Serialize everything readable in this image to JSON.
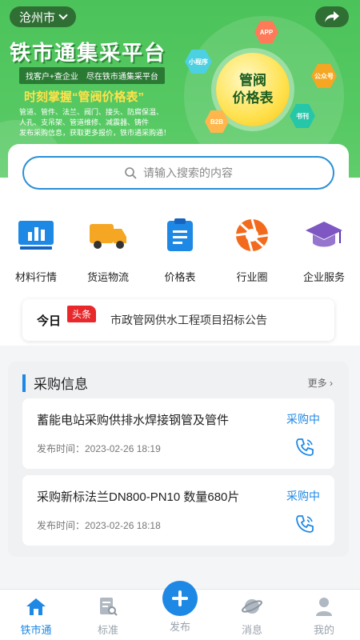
{
  "banner": {
    "city": "沧州市",
    "title": "铁市通集采平台",
    "tag": "找客户+查企业　尽在铁市通集采平台",
    "slogan": "时刻掌握“管阀价格表”",
    "desc_line1": "管道、管件、法兰、阀门、接头、防腐保温、",
    "desc_line2": "人孔、支吊架、管道维修、减震器、铸件",
    "desc_line3": "发布采购信息，获取更多报价，铁市通采购通！",
    "main_bubble_line1": "管阀",
    "main_bubble_line2": "价格表",
    "hex_app": "APP",
    "hex_mini": "小程序",
    "hex_gzh": "公众号",
    "hex_b2b": "B2B",
    "hex_book": "书刊"
  },
  "search": {
    "placeholder": "请输入搜索的内容"
  },
  "categories": [
    {
      "label": "材料行情",
      "icon": "chart-icon"
    },
    {
      "label": "货运物流",
      "icon": "truck-icon"
    },
    {
      "label": "价格表",
      "icon": "clipboard-icon"
    },
    {
      "label": "行业圈",
      "icon": "aperture-icon"
    },
    {
      "label": "企业服务",
      "icon": "graduation-cap-icon"
    }
  ],
  "news": {
    "today": "今日",
    "flag": "头条",
    "headline": "市政管网供水工程项目招标公告"
  },
  "purchase": {
    "title": "采购信息",
    "more": "更多",
    "items": [
      {
        "name": "蓄能电站采购供排水焊接钢管及管件",
        "status": "采购中",
        "time": "发布时间：2023-02-26 18:19"
      },
      {
        "name": "采购新标法兰DN800-PN10 数量680片",
        "status": "采购中",
        "time": "发布时间：2023-02-26 18:18"
      }
    ]
  },
  "tabbar": {
    "home": "铁市通",
    "standard": "标准",
    "publish": "发布",
    "message": "消息",
    "mine": "我的"
  },
  "colors": {
    "accent": "#1e88e5",
    "banner": "#4cc35a",
    "headline_flag": "#e8282b"
  }
}
